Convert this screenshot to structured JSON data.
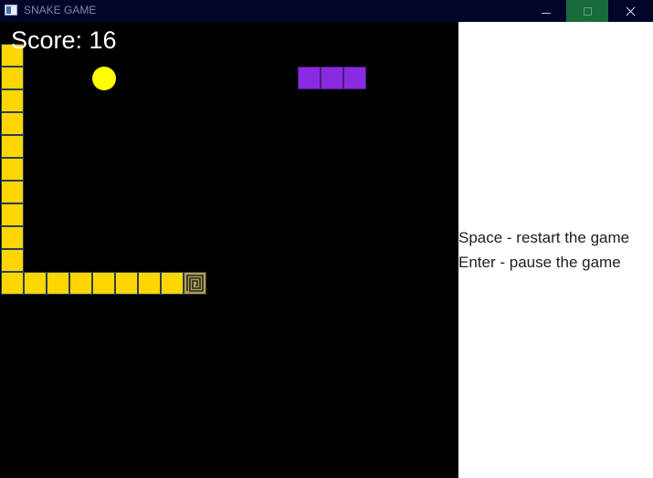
{
  "window": {
    "title": "SNAKE GAME",
    "titlebar_color": "#000529",
    "maximize_hover_color": "#176b3c",
    "controls": [
      "minimize-icon",
      "maximize-icon",
      "close-icon"
    ]
  },
  "game": {
    "score_label": "Score: 16",
    "background": "#000000",
    "snake_color": "#ffd700",
    "food_color": "#ffff00",
    "obstacle_color": "#8a2be2",
    "snake_body": [
      [
        0,
        0
      ],
      [
        0,
        1
      ],
      [
        0,
        2
      ],
      [
        0,
        3
      ],
      [
        0,
        4
      ],
      [
        0,
        5
      ],
      [
        0,
        6
      ],
      [
        0,
        7
      ],
      [
        0,
        8
      ],
      [
        0,
        9
      ],
      [
        0,
        10
      ],
      [
        1,
        10
      ],
      [
        2,
        10
      ],
      [
        3,
        10
      ],
      [
        4,
        10
      ],
      [
        5,
        10
      ],
      [
        6,
        10
      ],
      [
        7,
        10
      ]
    ],
    "snake_head": [
      8,
      10
    ],
    "food": [
      4,
      1
    ],
    "obstacles": [
      [
        13,
        1
      ],
      [
        14,
        1
      ],
      [
        15,
        1
      ]
    ]
  },
  "panel": {
    "background": "#ffffff",
    "help_restart": "Space - restart the game",
    "help_pause": "Enter - pause the game"
  }
}
